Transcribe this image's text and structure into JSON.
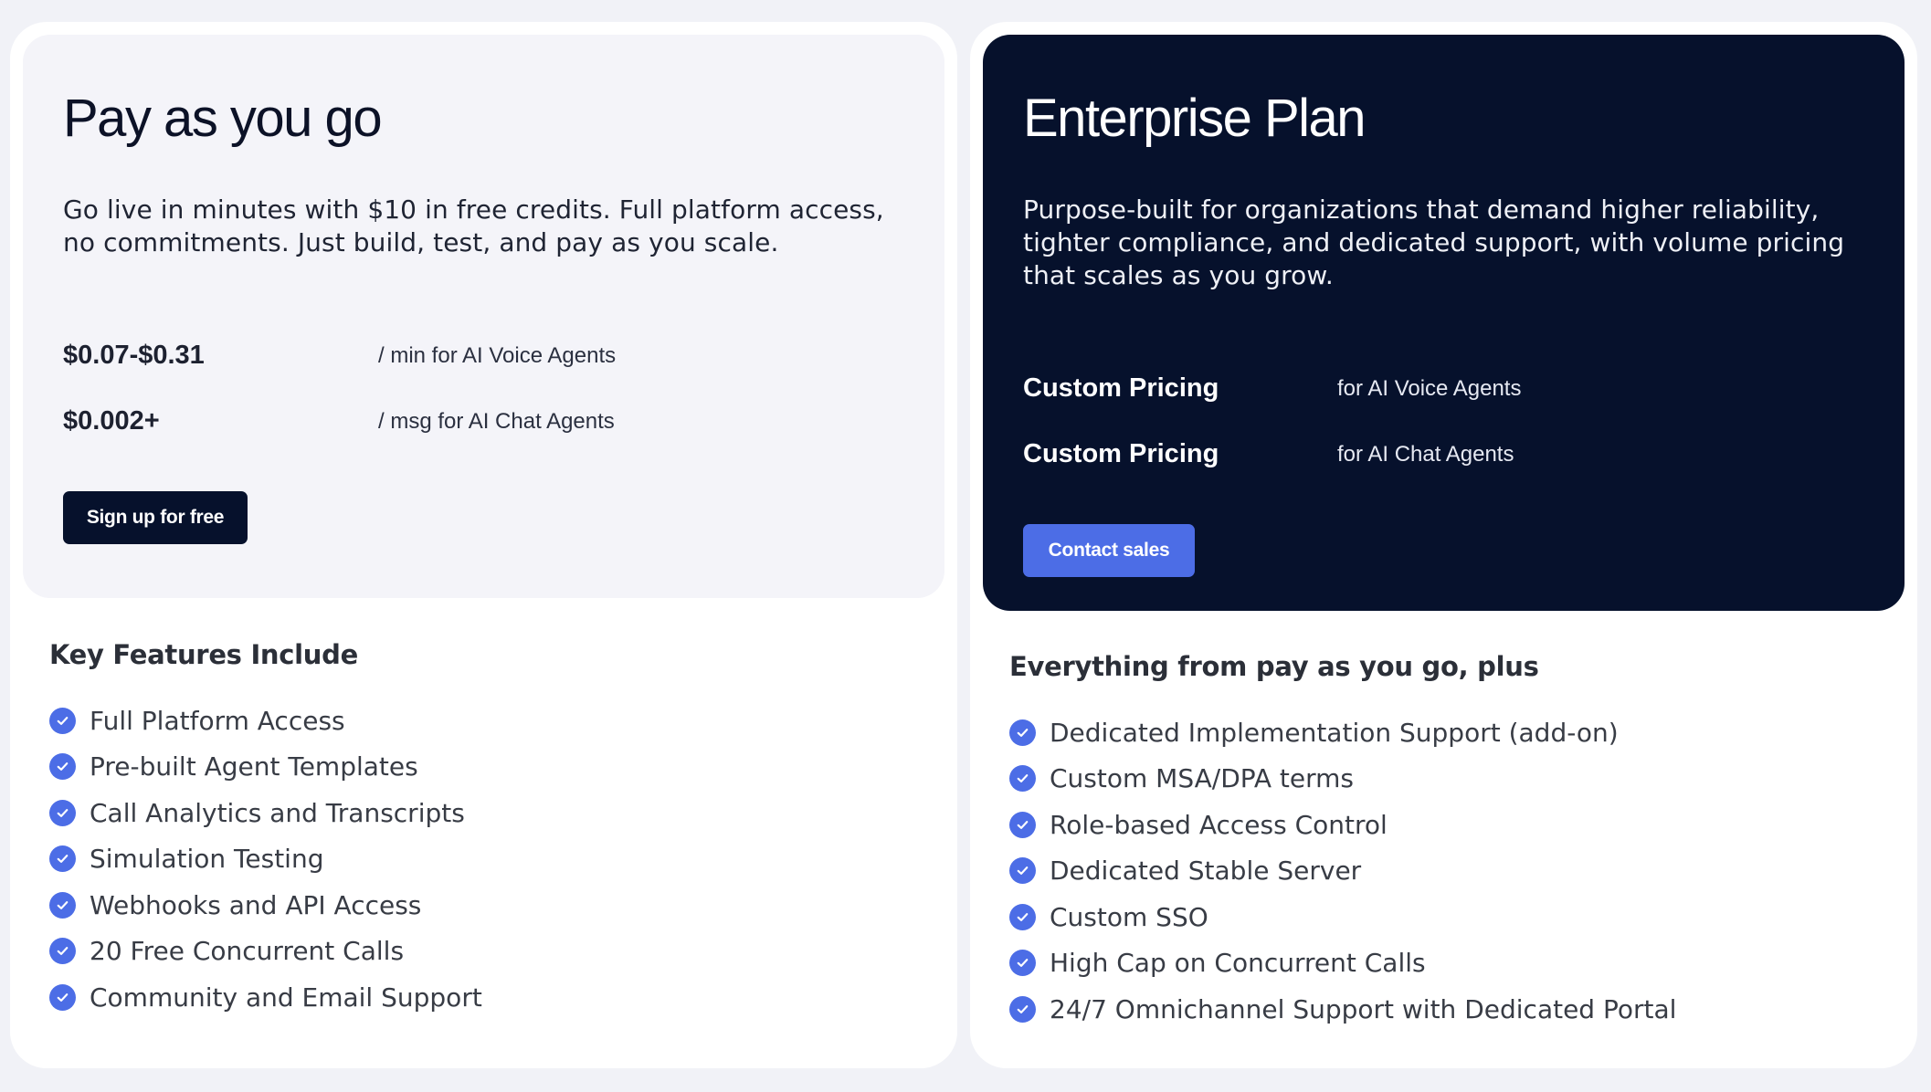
{
  "plans": [
    {
      "title": "Pay as you go",
      "description": "Go live in minutes with $10 in free credits. Full platform access, no commitments. Just build, test, and pay as you scale.",
      "prices": [
        {
          "value": "$0.07-$0.31",
          "unit": "/ min for AI Voice Agents"
        },
        {
          "value": "$0.002+",
          "unit": "/ msg for AI Chat Agents"
        }
      ],
      "cta_label": "Sign up for free",
      "features_heading": "Key Features Include",
      "features": [
        "Full Platform Access",
        "Pre-built Agent Templates",
        "Call Analytics and Transcripts",
        "Simulation Testing",
        "Webhooks and API Access",
        "20 Free Concurrent Calls",
        "Community and Email Support"
      ]
    },
    {
      "title": "Enterprise Plan",
      "description": "Purpose-built for organizations that demand higher reliability, tighter compliance, and dedicated support, with volume pricing that scales as you grow.",
      "prices": [
        {
          "value": "Custom Pricing",
          "unit": "for AI Voice Agents"
        },
        {
          "value": "Custom Pricing",
          "unit": "for AI Chat Agents"
        }
      ],
      "cta_label": "Contact sales",
      "features_heading": "Everything from pay as you go, plus",
      "features": [
        "Dedicated Implementation Support (add-on)",
        "Custom MSA/DPA terms",
        "Role-based Access Control",
        "Dedicated Stable Server",
        "Custom SSO",
        "High Cap on Concurrent Calls",
        "24/7 Omnichannel Support with Dedicated Portal"
      ]
    }
  ],
  "colors": {
    "page_bg": "#f1f2f7",
    "dark_navy": "#06112c",
    "accent_blue": "#4c6de6",
    "light_card": "#f4f4f9"
  },
  "icons": {
    "feature_check": "check-circle-icon"
  }
}
